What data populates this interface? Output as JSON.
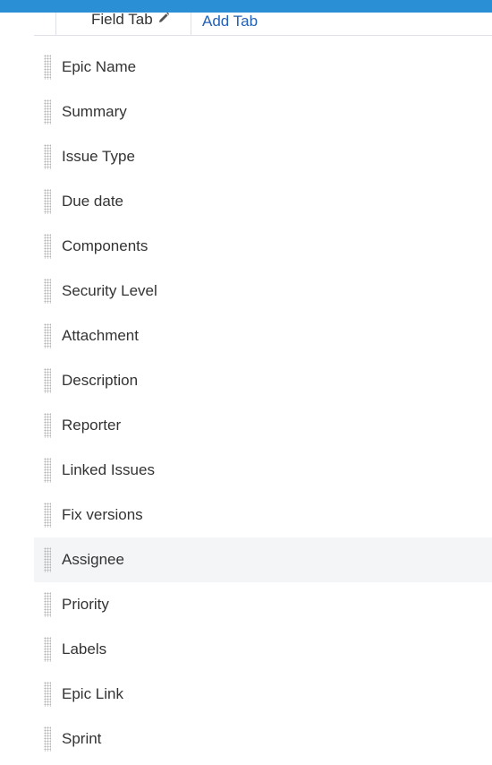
{
  "colors": {
    "top_bar": "#2b8fd6",
    "link": "#2461b5",
    "text": "#333333",
    "row_highlight": "#f4f5f7"
  },
  "tabs": {
    "current_label": "Field Tab",
    "edit_icon": "pencil-icon",
    "add_label": "Add Tab"
  },
  "fields": [
    {
      "label": "Epic Name"
    },
    {
      "label": "Summary"
    },
    {
      "label": "Issue Type"
    },
    {
      "label": "Due date"
    },
    {
      "label": "Components"
    },
    {
      "label": "Security Level"
    },
    {
      "label": "Attachment"
    },
    {
      "label": "Description"
    },
    {
      "label": "Reporter"
    },
    {
      "label": "Linked Issues"
    },
    {
      "label": "Fix versions"
    },
    {
      "label": "Assignee",
      "highlighted": true
    },
    {
      "label": "Priority"
    },
    {
      "label": "Labels"
    },
    {
      "label": "Epic Link"
    },
    {
      "label": "Sprint"
    }
  ]
}
